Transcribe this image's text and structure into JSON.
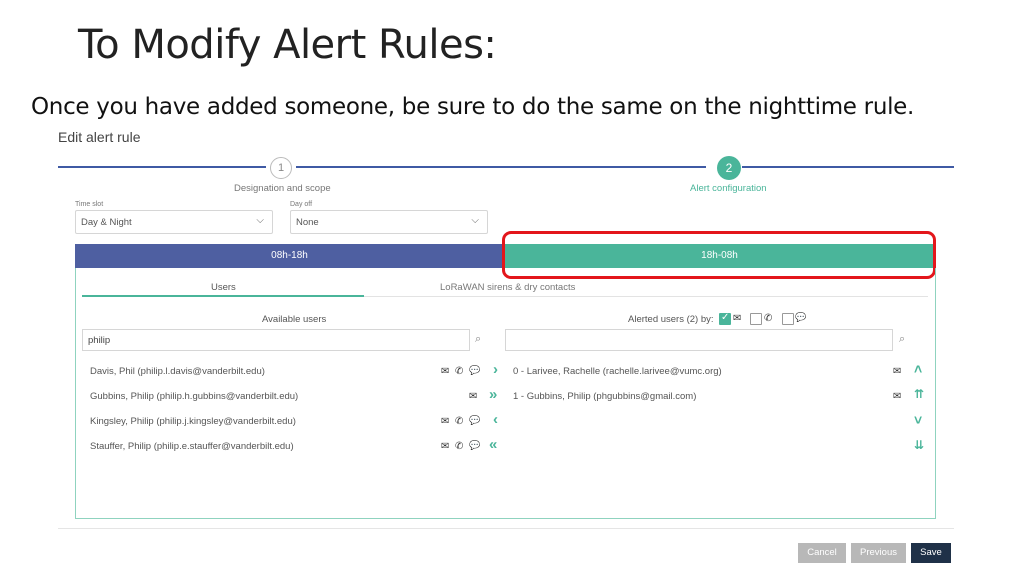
{
  "slide": {
    "title": "To Modify Alert Rules:",
    "subtitle": "Once you have added someone, be sure to do the same on the nighttime rule."
  },
  "panel": {
    "title": "Edit alert rule"
  },
  "stepper": {
    "steps": [
      {
        "number": "1",
        "label": "Designation and scope"
      },
      {
        "number": "2",
        "label": "Alert configuration"
      }
    ]
  },
  "fields": {
    "time_slot": {
      "label": "Time slot",
      "value": "Day & Night"
    },
    "day_off": {
      "label": "Day off",
      "value": "None"
    }
  },
  "time_tabs": [
    "08h-18h",
    "18h-08h"
  ],
  "sub_tabs": [
    "Users",
    "LoRaWAN sirens & dry contacts"
  ],
  "available": {
    "label": "Available users",
    "search_value": "philip",
    "users": [
      "Davis, Phil (philip.l.davis@vanderbilt.edu)",
      "Gubbins, Philip (philip.h.gubbins@vanderbilt.edu)",
      "Kingsley, Philip (philip.j.kingsley@vanderbilt.edu)",
      "Stauffer, Philip (philip.e.stauffer@vanderbilt.edu)"
    ]
  },
  "alerted": {
    "label": "Alerted users (2) by:",
    "search_value": "",
    "users": [
      "0 - Larivee, Rachelle (rachelle.larivee@vumc.org)",
      "1 - Gubbins, Philip (phgubbins@gmail.com)"
    ]
  },
  "icons": {
    "mail": "✉",
    "phone": "✆",
    "chat": "💬",
    "search": "⌕",
    "chevron_down": "⌵",
    "right": "›",
    "double_right": "»",
    "left": "‹",
    "double_left": "«",
    "up": "˄",
    "double_up": "⇈",
    "down": "˅",
    "double_down": "⇊"
  },
  "buttons": {
    "cancel": "Cancel",
    "previous": "Previous",
    "save": "Save"
  },
  "colors": {
    "accent": "#4ab59a",
    "primary": "#4e5fa1",
    "highlight": "#e3161b",
    "save": "#1f3148"
  }
}
